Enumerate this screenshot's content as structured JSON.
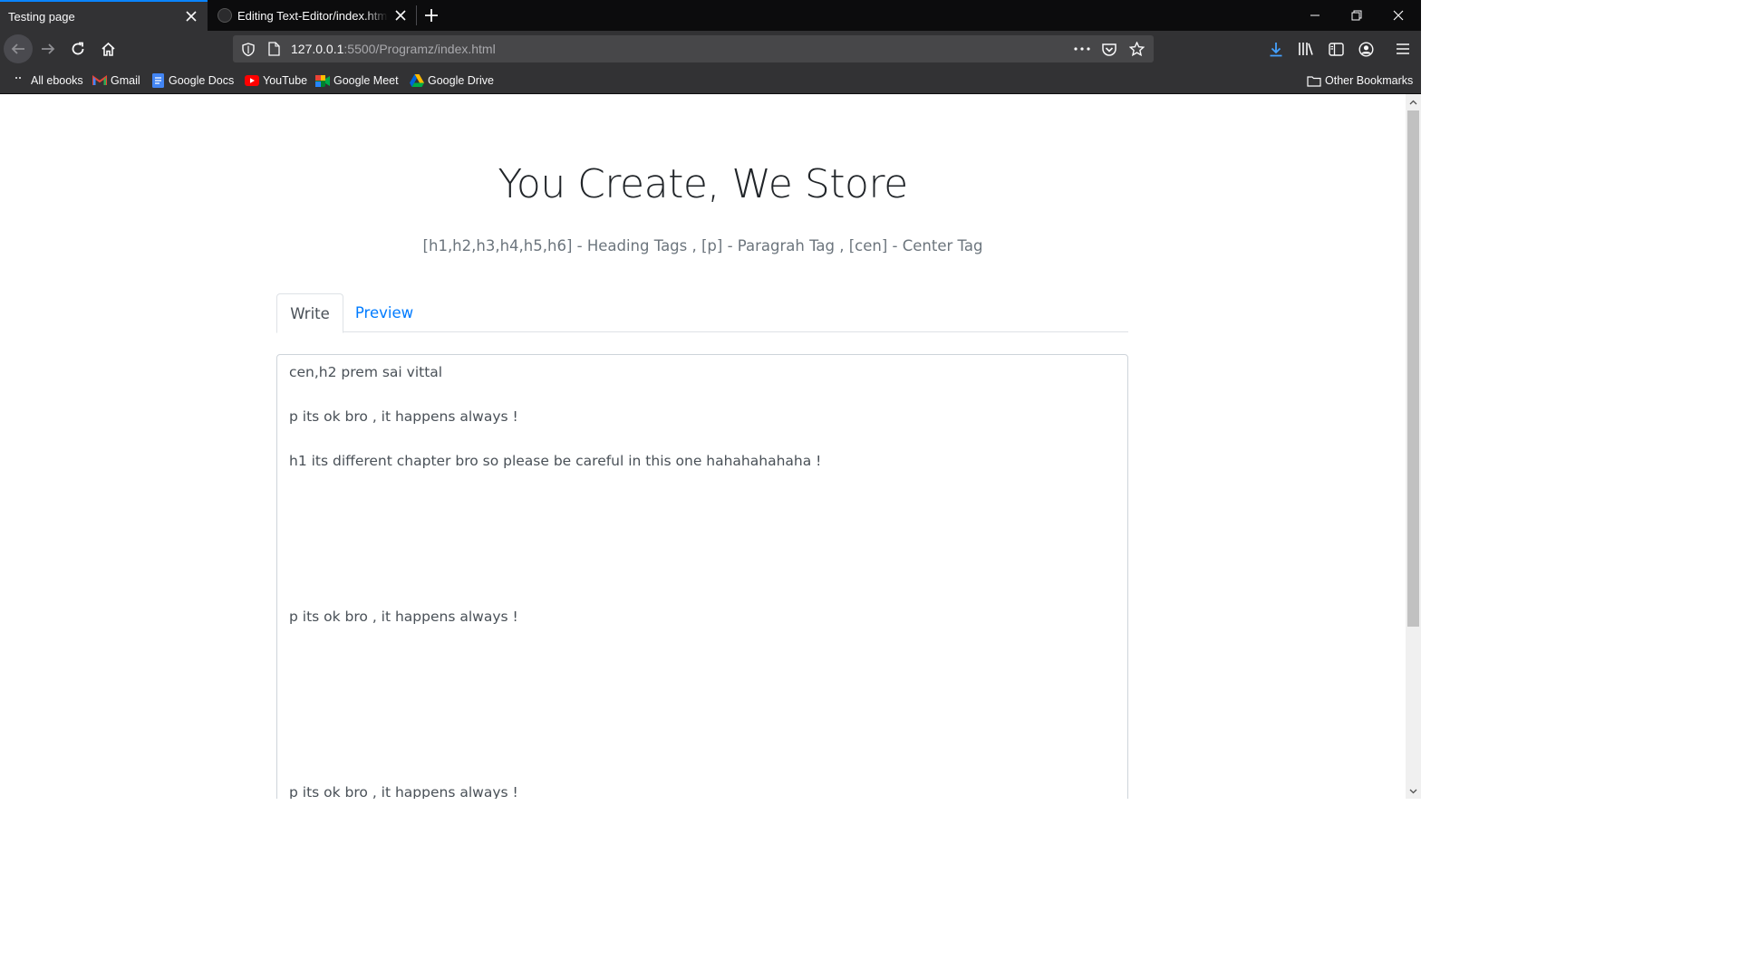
{
  "browser": {
    "tabs": [
      {
        "title": "Testing page",
        "active": true
      },
      {
        "title": "Editing Text-Editor/index.html at",
        "active": false
      }
    ],
    "url": {
      "host": "127.0.0.1",
      "rest": ":5500/Programz/index.html"
    },
    "bookmarks": [
      {
        "label": "All ebooks",
        "icon": "folder-dots-icon"
      },
      {
        "label": "Gmail",
        "icon": "gmail-icon"
      },
      {
        "label": "Google Docs",
        "icon": "google-docs-icon"
      },
      {
        "label": "YouTube",
        "icon": "youtube-icon"
      },
      {
        "label": "Google Meet",
        "icon": "google-meet-icon"
      },
      {
        "label": "Google Drive",
        "icon": "google-drive-icon"
      }
    ],
    "other_bookmarks": "Other Bookmarks"
  },
  "page": {
    "title": "You Create, We Store",
    "subtitle": "[h1,h2,h3,h4,h5,h6] - Heading Tags , [p] - Paragrah Tag , [cen] - Center Tag",
    "tabs": {
      "write": "Write",
      "preview": "Preview"
    },
    "editor_lines": [
      "cen,h2 prem sai vittal",
      "p its ok bro , it happens always !",
      "h1 its different chapter bro so please be careful in this one hahahahahaha !",
      "p its ok bro , it happens always !",
      "p its ok bro , it happens always !"
    ]
  },
  "colors": {
    "accent": "#0a84ff",
    "link": "#007bff",
    "chrome": "#323234",
    "tabstrip": "#0c0c0d"
  }
}
